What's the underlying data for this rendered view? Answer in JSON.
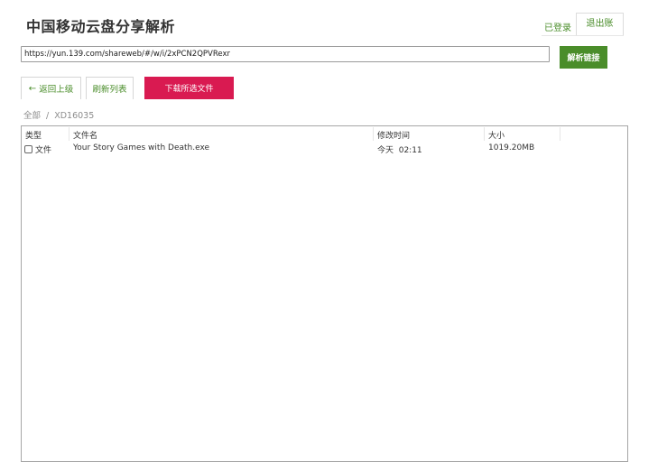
{
  "header": {
    "title": "中国移动云盘分享解析",
    "login_status": "已登录",
    "logout_label": "退出账"
  },
  "url_bar": {
    "value": "https://yun.139.com/shareweb/#/w/i/2xPCN2QPVRexr",
    "parse_label": "解析链接"
  },
  "toolbar": {
    "back_arrow": "←",
    "back_label": "返回上级",
    "refresh_label": "刷新列表",
    "download_label": "下载所选文件"
  },
  "breadcrumb": {
    "root": "全部",
    "separator": "/",
    "current": "XD16035"
  },
  "file_table": {
    "columns": [
      "类型",
      "文件名",
      "修改时间",
      "大小"
    ],
    "rows": [
      {
        "type": "文件",
        "name": "Your Story Games with Death.exe",
        "modified": "今天  02:11",
        "size": "1019.20MB",
        "checked": false
      }
    ]
  },
  "colors": {
    "accent_green": "#4a8d2a",
    "download_red": "#d91a51"
  },
  "icons": {
    "checkbox": "checkbox-icon",
    "back": "arrow-left-icon"
  }
}
